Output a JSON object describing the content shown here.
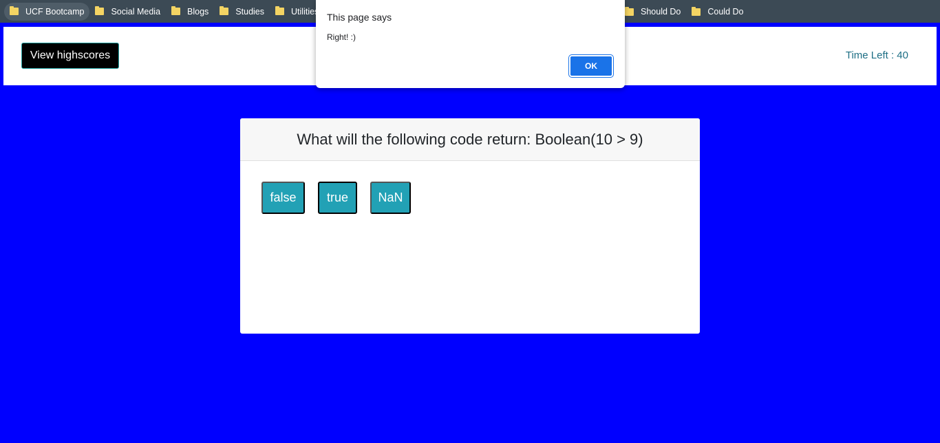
{
  "bookmarks": {
    "items": [
      {
        "label": "UCF Bootcamp"
      },
      {
        "label": "Social Media"
      },
      {
        "label": "Blogs"
      },
      {
        "label": "Studies"
      },
      {
        "label": "Utilities"
      }
    ],
    "right_items": [
      {
        "label": "Should Do"
      },
      {
        "label": "Could Do"
      }
    ]
  },
  "header": {
    "highscores_label": "View highscores",
    "timer_text": "Time Left : 40"
  },
  "quiz": {
    "question": "What will the following code return: Boolean(10 > 9)",
    "choices": [
      {
        "label": "false"
      },
      {
        "label": "true"
      },
      {
        "label": "NaN"
      }
    ]
  },
  "dialog": {
    "title": "This page says",
    "message": "Right! :)",
    "ok_label": "OK"
  },
  "colors": {
    "background": "#0000ff",
    "choice_button": "#22a1b5",
    "ok_button": "#1a73e8",
    "bookmarks_bar": "#3c4a55"
  }
}
